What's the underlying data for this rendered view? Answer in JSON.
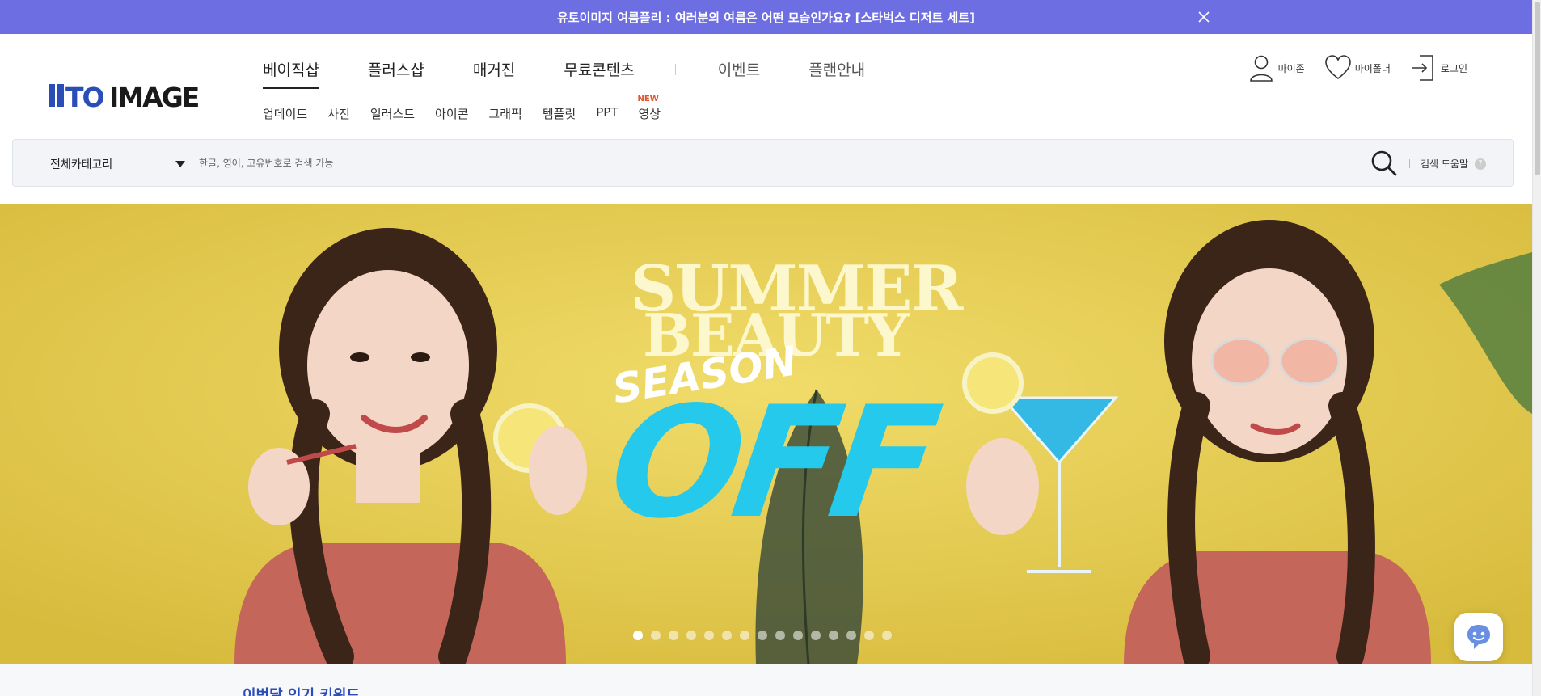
{
  "notice": {
    "text": "유토이미지 여름플리 : 여러분의 여름은 어떤 모습인가요? [스타벅스 디저트 세트]"
  },
  "brand": {
    "logo_text": "UTOIMAGE",
    "primary": "#2b4db7",
    "accent": "#6e6ee3"
  },
  "main_nav": [
    {
      "label": "베이직샵",
      "active": true
    },
    {
      "label": "플러스샵"
    },
    {
      "label": "매거진"
    },
    {
      "label": "무료콘텐츠"
    },
    {
      "label": "이벤트"
    },
    {
      "label": "플랜안내"
    }
  ],
  "sub_nav": [
    {
      "label": "업데이트"
    },
    {
      "label": "사진"
    },
    {
      "label": "일러스트"
    },
    {
      "label": "아이콘"
    },
    {
      "label": "그래픽"
    },
    {
      "label": "템플릿"
    },
    {
      "label": "PPT"
    },
    {
      "label": "영상",
      "badge": "NEW"
    }
  ],
  "user_menu": [
    {
      "label": "마이존",
      "icon": "user-icon"
    },
    {
      "label": "마이폴더",
      "icon": "heart-icon"
    },
    {
      "label": "로그인",
      "icon": "login-icon"
    }
  ],
  "search": {
    "category": "전체카테고리",
    "placeholder": "한글, 영어, 고유번호로 검색 가능",
    "help_label": "검색 도움말",
    "help_glyph": "?"
  },
  "banner": {
    "line1": "SUMMER",
    "line2": "BEAUTY",
    "line3": "SEASON",
    "line4": "OFF",
    "dots_total": 15,
    "dots_active_index": 0,
    "bg_color": "#e6cd52",
    "accent_color": "#25c9ec"
  },
  "bottom": {
    "peek": "이번달 인기 키워드"
  }
}
